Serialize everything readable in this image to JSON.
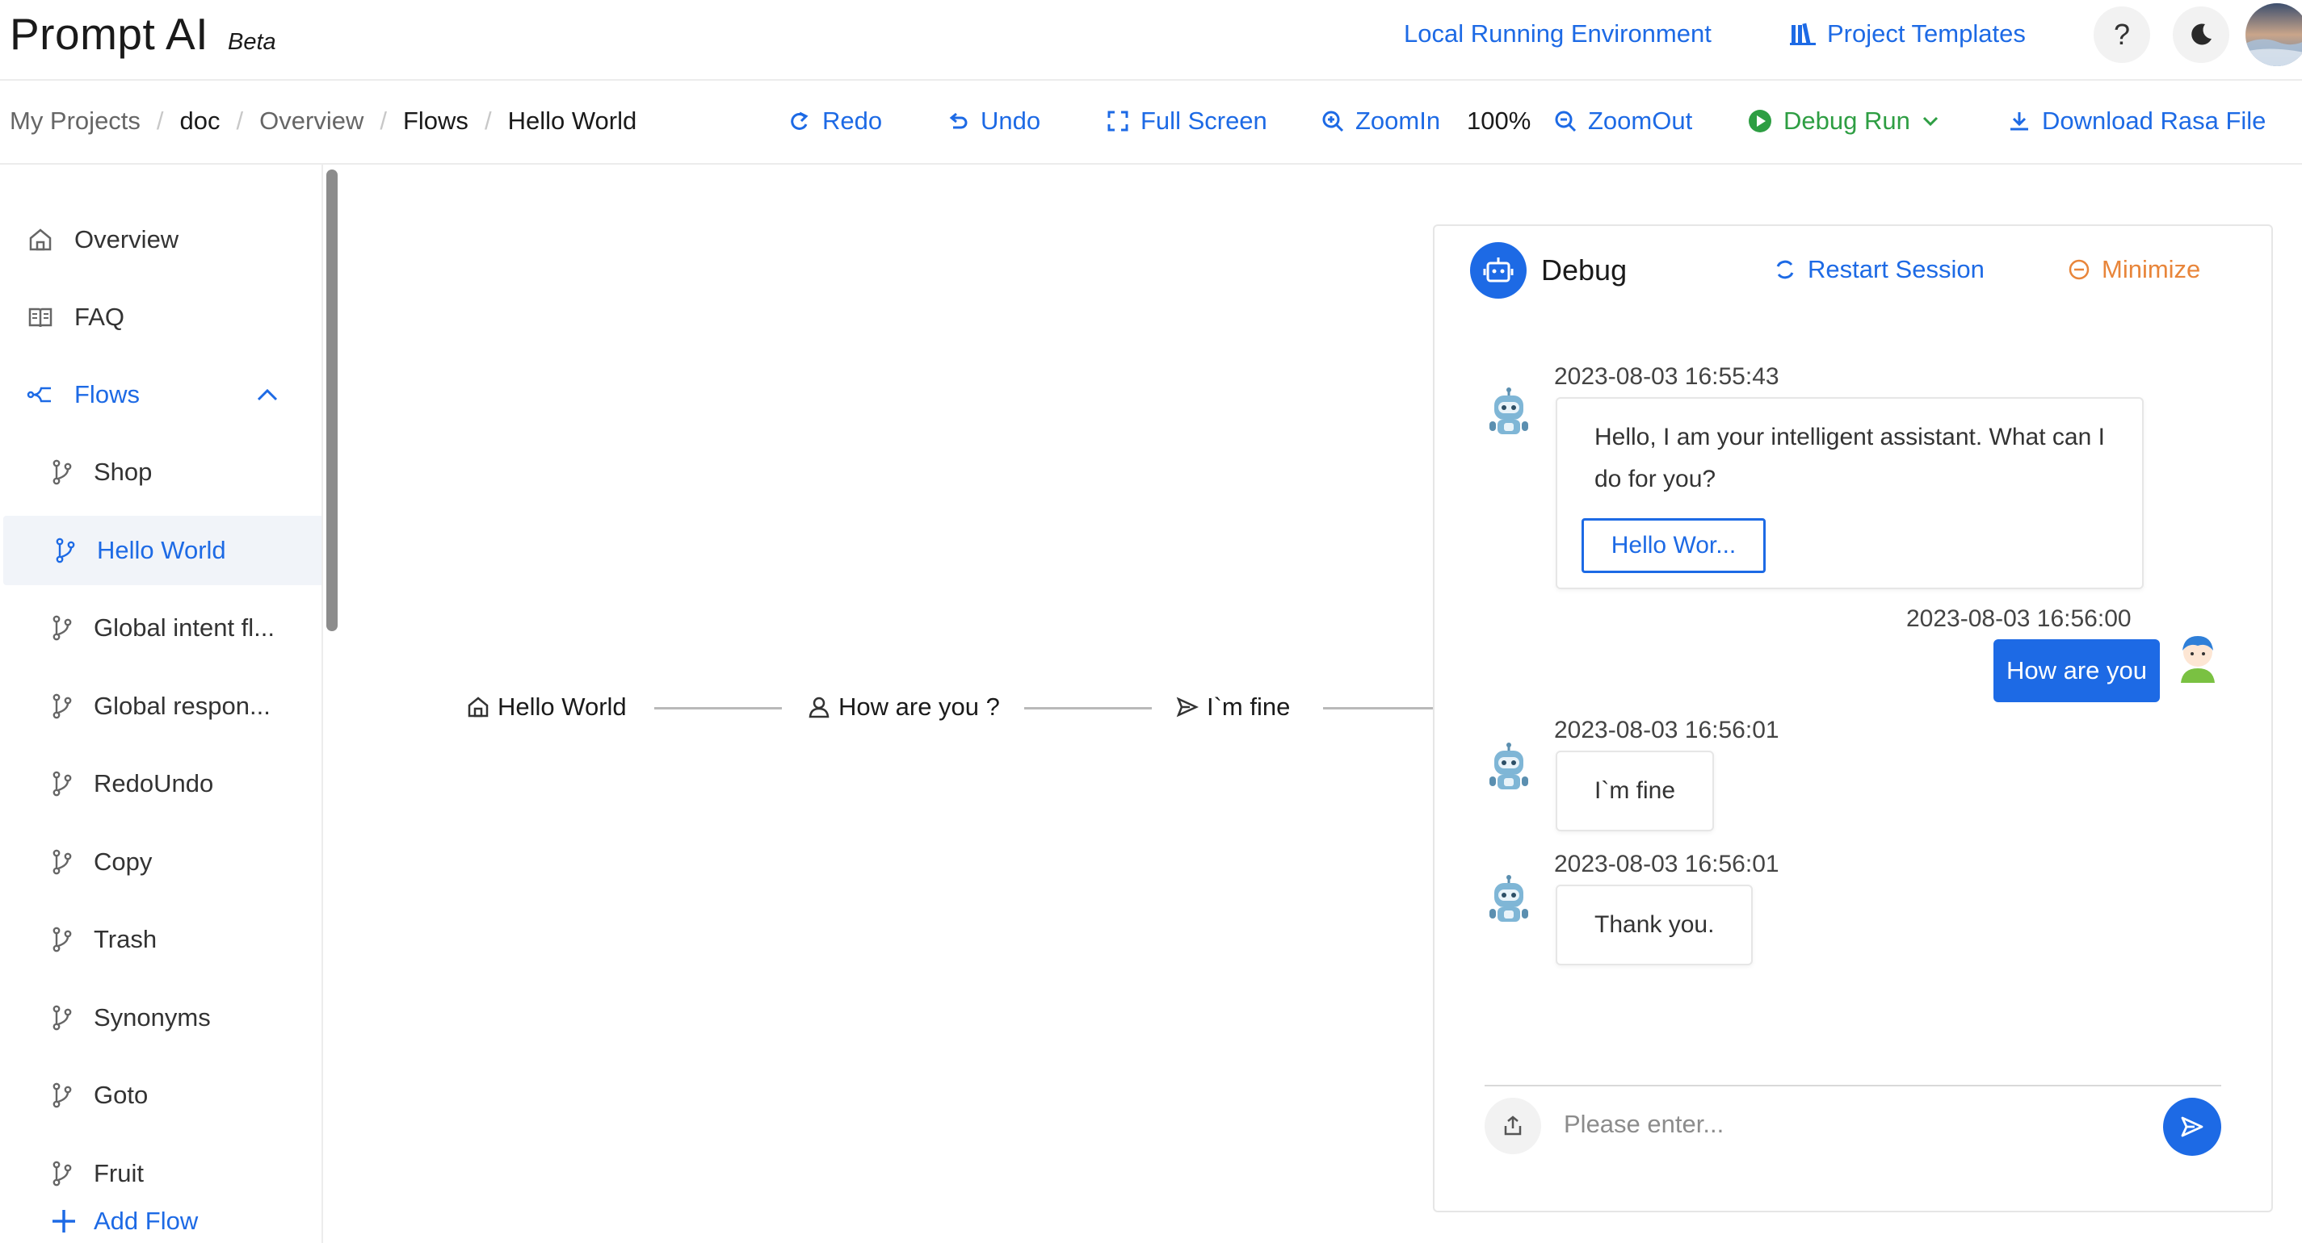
{
  "header": {
    "brand": "Prompt AI",
    "badge": "Beta",
    "local_env": "Local Running Environment",
    "project_templates": "Project Templates",
    "help_label": "?"
  },
  "breadcrumb": [
    "My Projects",
    "doc",
    "Overview",
    "Flows",
    "Hello World"
  ],
  "toolbar": {
    "redo": "Redo",
    "undo": "Undo",
    "full_screen": "Full Screen",
    "zoom_in": "ZoomIn",
    "zoom_level": "100%",
    "zoom_out": "ZoomOut",
    "debug_run": "Debug Run",
    "download": "Download Rasa File"
  },
  "sidebar": {
    "overview": "Overview",
    "faq": "FAQ",
    "flows": "Flows",
    "flow_items": [
      "Shop",
      "Hello World",
      "Global intent fl...",
      "Global respon...",
      "RedoUndo",
      "Copy",
      "Trash",
      "Synonyms",
      "Goto",
      "Fruit"
    ],
    "active_flow": "Hello World",
    "add_flow": "Add Flow"
  },
  "canvas": {
    "nodes": [
      "Hello World",
      "How are you ?",
      "I`m fine"
    ]
  },
  "debug": {
    "title": "Debug",
    "restart": "Restart Session",
    "minimize": "Minimize",
    "messages": [
      {
        "time": "2023-08-03 16:55:43",
        "text": "Hello, I am your intelligent assistant. What can I do for you?",
        "button": "Hello Wor..."
      },
      {
        "time": "2023-08-03 16:56:00",
        "text": "How are you"
      },
      {
        "time": "2023-08-03 16:56:01",
        "text": "I`m fine"
      },
      {
        "time": "2023-08-03 16:56:01",
        "text": "Thank you."
      }
    ],
    "input_placeholder": "Please enter..."
  },
  "colors": {
    "accent": "#1d6ae5",
    "debug_run": "#2e9e43",
    "minimize": "#e8853a"
  }
}
